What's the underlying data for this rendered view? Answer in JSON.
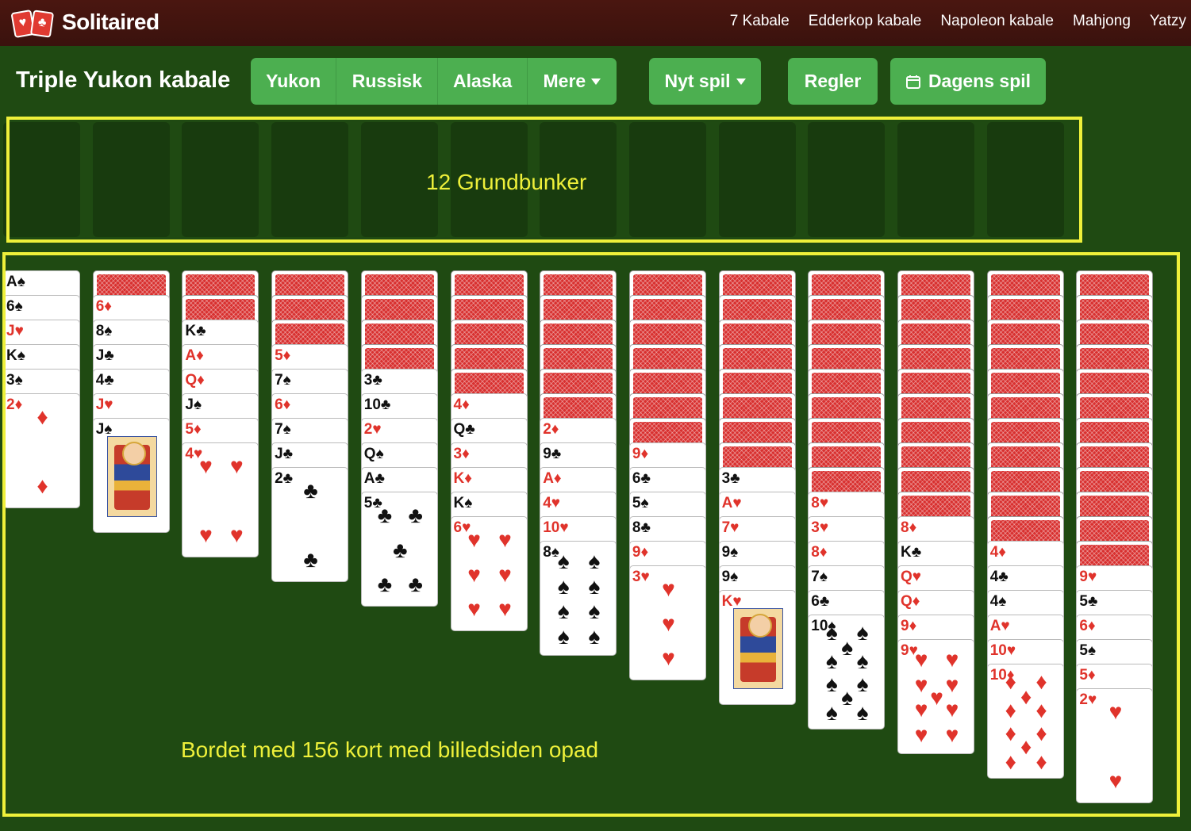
{
  "header": {
    "logo_text": "Solitaired",
    "nav": [
      "7 Kabale",
      "Edderkop kabale",
      "Napoleon kabale",
      "Mahjong",
      "Yatzy"
    ]
  },
  "toolbar": {
    "title": "Triple Yukon kabale",
    "variants": [
      "Yukon",
      "Russisk",
      "Alaska",
      "Mere"
    ],
    "new_game": "Nyt spil",
    "rules": "Regler",
    "daily": "Dagens spil"
  },
  "annotations": {
    "foundations": "12 Grundbunker",
    "tableau": "Bordet med 156 kort med billedsiden opad"
  },
  "colors": {
    "accent": "#4caf50",
    "highlight": "#eef03a",
    "felt": "#1f4a12",
    "topbar": "#4a1610"
  },
  "foundations": {
    "count": 12
  },
  "tableau": [
    {
      "down": 0,
      "up": [
        "A♠",
        "6♠",
        "J♥",
        "K♠",
        "3♠",
        "2♦"
      ]
    },
    {
      "down": 1,
      "up": [
        "6♦",
        "8♠",
        "J♣",
        "4♣",
        "J♥",
        "J♠"
      ]
    },
    {
      "down": 2,
      "up": [
        "K♣",
        "A♦",
        "Q♦",
        "J♠",
        "5♦",
        "4♥"
      ]
    },
    {
      "down": 3,
      "up": [
        "5♦",
        "7♠",
        "6♦",
        "7♠",
        "J♣",
        "2♣"
      ]
    },
    {
      "down": 4,
      "up": [
        "3♣",
        "10♣",
        "2♥",
        "Q♠",
        "A♣",
        "5♣"
      ]
    },
    {
      "down": 5,
      "up": [
        "4♦",
        "Q♣",
        "3♦",
        "K♦",
        "K♠",
        "6♥"
      ]
    },
    {
      "down": 6,
      "up": [
        "2♦",
        "9♣",
        "A♦",
        "4♥",
        "10♥",
        "8♠"
      ]
    },
    {
      "down": 7,
      "up": [
        "9♦",
        "6♣",
        "5♠",
        "8♣",
        "9♦",
        "3♥"
      ]
    },
    {
      "down": 8,
      "up": [
        "3♣",
        "A♥",
        "7♥",
        "9♠",
        "9♠",
        "K♥"
      ]
    },
    {
      "down": 9,
      "up": [
        "8♥",
        "3♥",
        "8♦",
        "7♠",
        "6♣",
        "10♠"
      ]
    },
    {
      "down": 10,
      "up": [
        "8♦",
        "K♣",
        "Q♥",
        "Q♦",
        "9♦",
        "9♥"
      ]
    },
    {
      "down": 11,
      "up": [
        "4♦",
        "4♣",
        "4♠",
        "A♥",
        "10♥",
        "10♦"
      ]
    },
    {
      "down": 12,
      "up": [
        "9♥",
        "5♣",
        "6♦",
        "5♠",
        "5♦",
        "2♥"
      ]
    }
  ]
}
